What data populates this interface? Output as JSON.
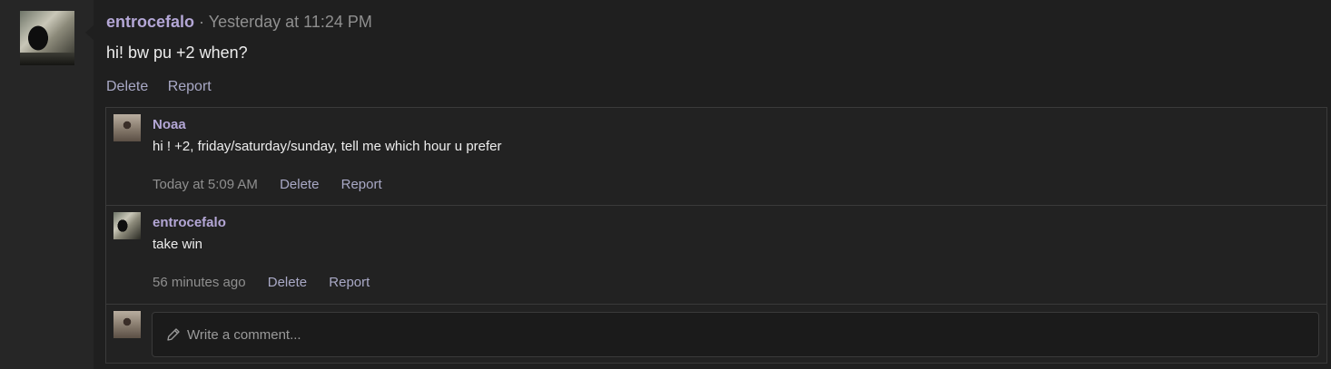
{
  "post": {
    "author": "entrocefalo",
    "separator": "·",
    "timestamp": "Yesterday at 11:24 PM",
    "body": "hi! bw pu +2 when?",
    "actions": {
      "delete": "Delete",
      "report": "Report"
    }
  },
  "comments": [
    {
      "author": "Noaa",
      "text": "hi ! +2, friday/saturday/sunday, tell me which hour u prefer",
      "timestamp": "Today at 5:09 AM",
      "actions": {
        "delete": "Delete",
        "report": "Report"
      }
    },
    {
      "author": "entrocefalo",
      "text": "take win",
      "timestamp": "56 minutes ago",
      "actions": {
        "delete": "Delete",
        "report": "Report"
      }
    }
  ],
  "composer": {
    "placeholder": "Write a comment...",
    "value": "",
    "icon": "pencil-icon"
  },
  "colors": {
    "background": "#1f1f1f",
    "gutter": "#262626",
    "author": "#b4a7d6",
    "muted": "#8f8f8f",
    "link": "#a9a9c6"
  }
}
